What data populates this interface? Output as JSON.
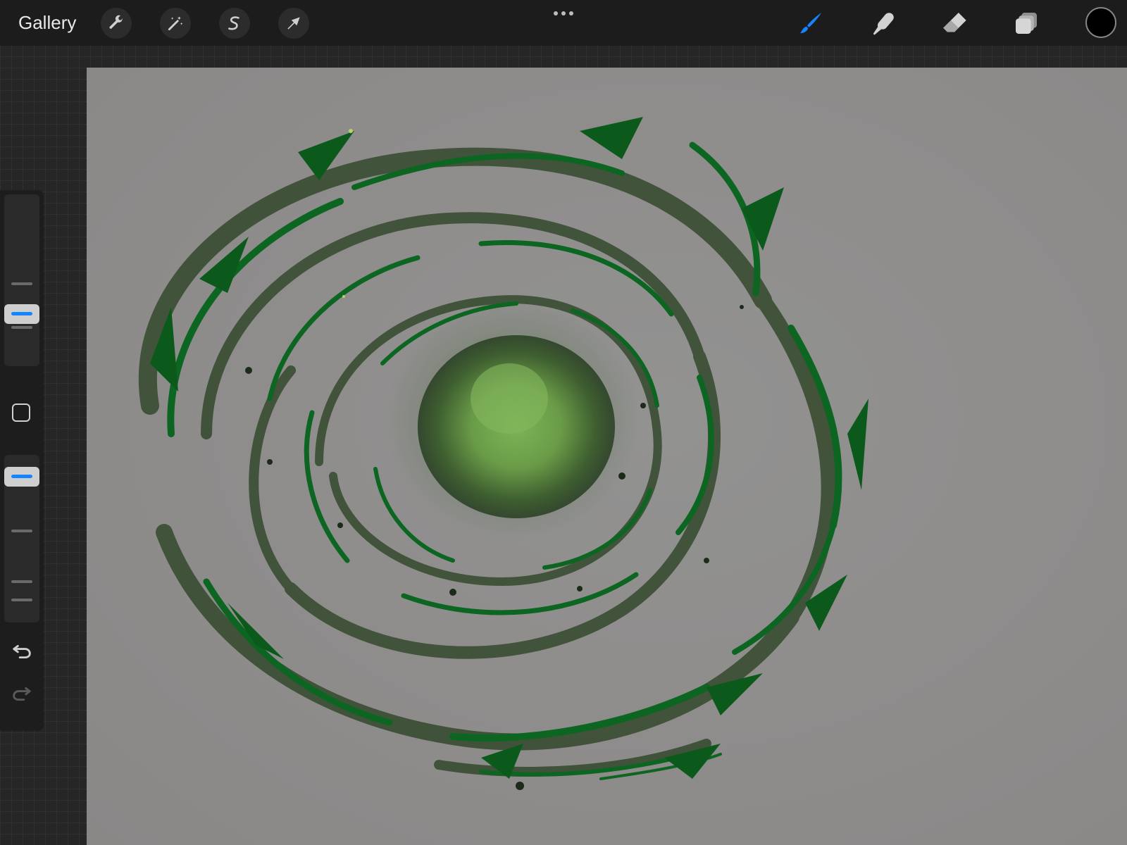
{
  "topbar": {
    "gallery_label": "Gallery",
    "left_tools": [
      {
        "name": "actions",
        "icon": "wrench-icon"
      },
      {
        "name": "adjustments",
        "icon": "magic-wand-icon"
      },
      {
        "name": "selection",
        "icon": "selection-s-icon"
      },
      {
        "name": "transform",
        "icon": "arrow-cursor-icon"
      }
    ],
    "more_icon": "more-dots-icon",
    "right_tools": [
      {
        "name": "brush",
        "icon": "brush-icon",
        "active": true
      },
      {
        "name": "smudge",
        "icon": "smudge-finger-icon",
        "active": false
      },
      {
        "name": "eraser",
        "icon": "eraser-icon",
        "active": false
      },
      {
        "name": "layers",
        "icon": "layers-icon",
        "active": false
      }
    ],
    "current_color": "#000000",
    "active_color": "#1683ff"
  },
  "sidebar": {
    "brush_size": 0.3,
    "brush_opacity": 0.85,
    "modify_icon": "square-modify-icon",
    "undo_icon": "undo-arrow-icon",
    "redo_icon": "redo-arrow-icon"
  },
  "canvas": {
    "background": "#8e8c8b",
    "artwork": "green-swirl-vortex-illustration",
    "colors": [
      "#0c5e1f",
      "#2f4a28",
      "#76a84e"
    ]
  }
}
